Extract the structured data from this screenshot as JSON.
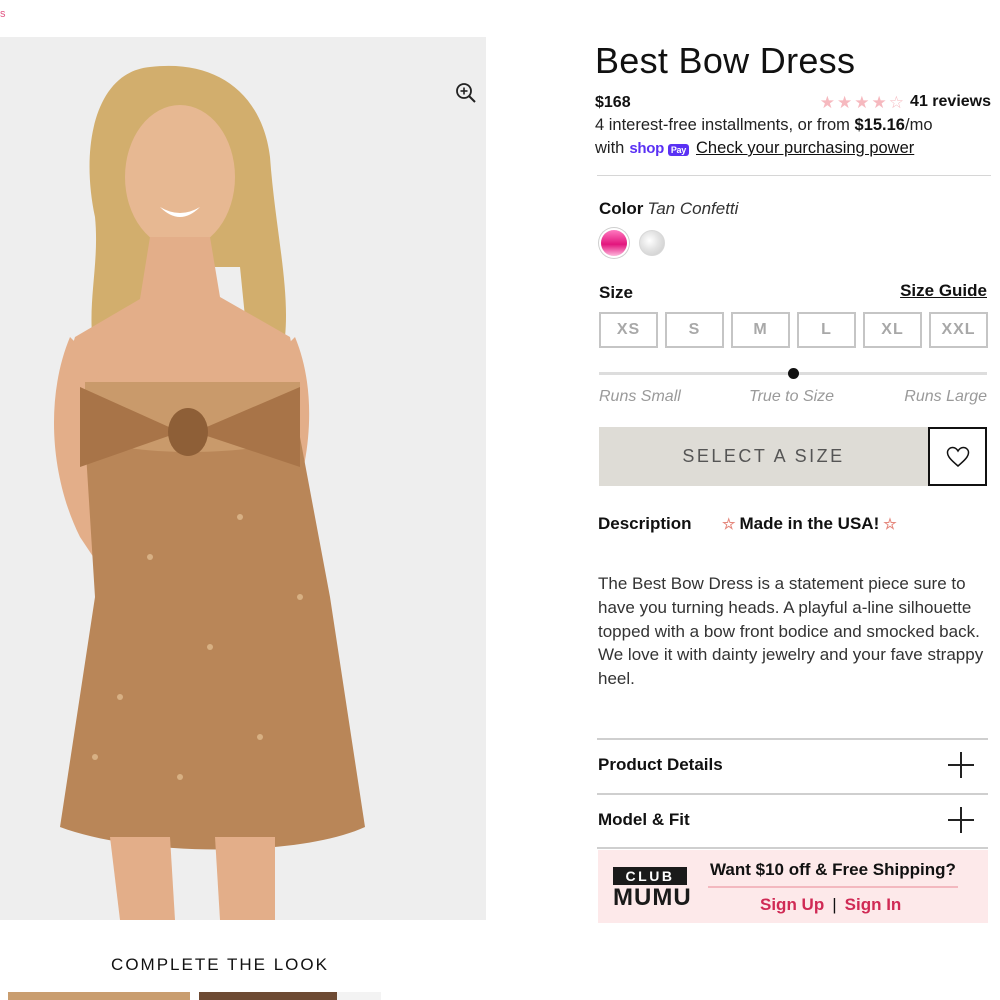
{
  "edge_text": "s",
  "product": {
    "title": "Best Bow Dress",
    "price": "$168",
    "reviews": "41 reviews",
    "rating": 4.5,
    "installments_prefix": "4 interest-free installments, or from ",
    "installment_amount": "$15.16",
    "installment_suffix": "/mo",
    "with_text": "with",
    "shop_text": "shop",
    "pay_text": "Pay",
    "check_power": "Check your purchasing power"
  },
  "color": {
    "label": "Color",
    "selected": "Tan Confetti",
    "swatches": [
      "pink-confetti",
      "silver-confetti"
    ]
  },
  "size": {
    "label": "Size",
    "guide": "Size Guide",
    "options": [
      "XS",
      "S",
      "M",
      "L",
      "XL",
      "XXL"
    ]
  },
  "fit": {
    "labels": [
      "Runs Small",
      "True to Size",
      "Runs Large"
    ],
    "position": "True to Size"
  },
  "actions": {
    "select_size": "SELECT A SIZE",
    "wishlist_icon": "heart-icon"
  },
  "tabs": {
    "description": "Description",
    "made_in_usa": "Made in the USA!"
  },
  "description_text": "The Best Bow Dress is a statement piece sure to have you turning heads. A playful a-line silhouette topped with a bow front bodice and smocked back. We love it with dainty jewelry and your fave strappy heel.",
  "accordion": [
    "Product Details",
    "Model & Fit"
  ],
  "club": {
    "logo_top": "CLUB",
    "logo_bottom": "MUMU",
    "promo": "Want $10 off & Free Shipping?",
    "sign_up": "Sign Up",
    "separator": "|",
    "sign_in": "Sign In"
  },
  "complete_the_look": "COMPLETE THE LOOK",
  "colors": {
    "accent_pink": "#d02a55",
    "shop_purple": "#5a31f4",
    "star": "#f6b9bf",
    "select_bg": "#dedcd6",
    "club_bg": "#fde9ea"
  }
}
